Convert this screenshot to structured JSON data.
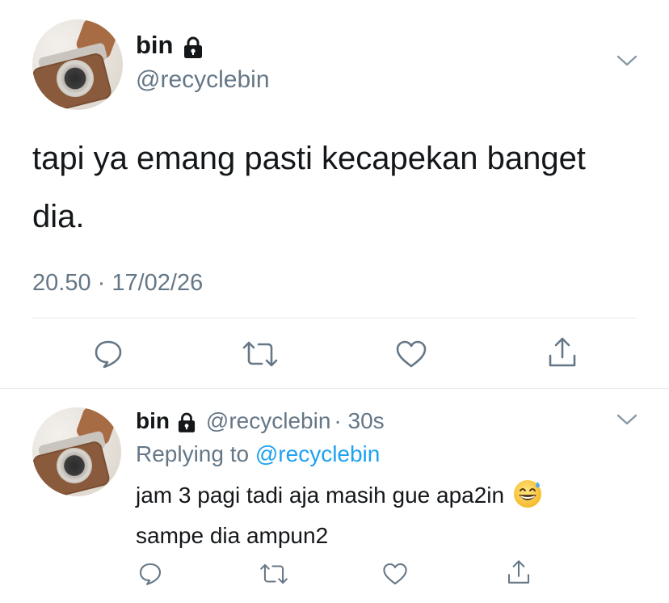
{
  "tweet": {
    "name": "bin",
    "handle": "@recyclebin",
    "text": "tapi ya emang pasti kecapekan banget dia.",
    "timestamp": "20.50 · 17/02/26",
    "icons": {
      "lock": "lock-icon",
      "menu": "chevron-down-icon",
      "reply": "comment-icon",
      "retweet": "retweet-icon",
      "like": "heart-icon",
      "share": "share-icon"
    }
  },
  "reply": {
    "name": "bin",
    "handle": "@recyclebin",
    "age": "· 30s",
    "replying_prefix": "Replying to",
    "replying_handle": "@recyclebin",
    "text_line1": "jam 3 pagi tadi aja masih gue apa2in",
    "text_line2": "sampe dia ampun2",
    "emoji": "grinning-face-with-sweat-emoji"
  },
  "colors": {
    "text": "#14171a",
    "secondary": "#657786",
    "link": "#1da1f2",
    "divider": "#e1e8ed"
  }
}
